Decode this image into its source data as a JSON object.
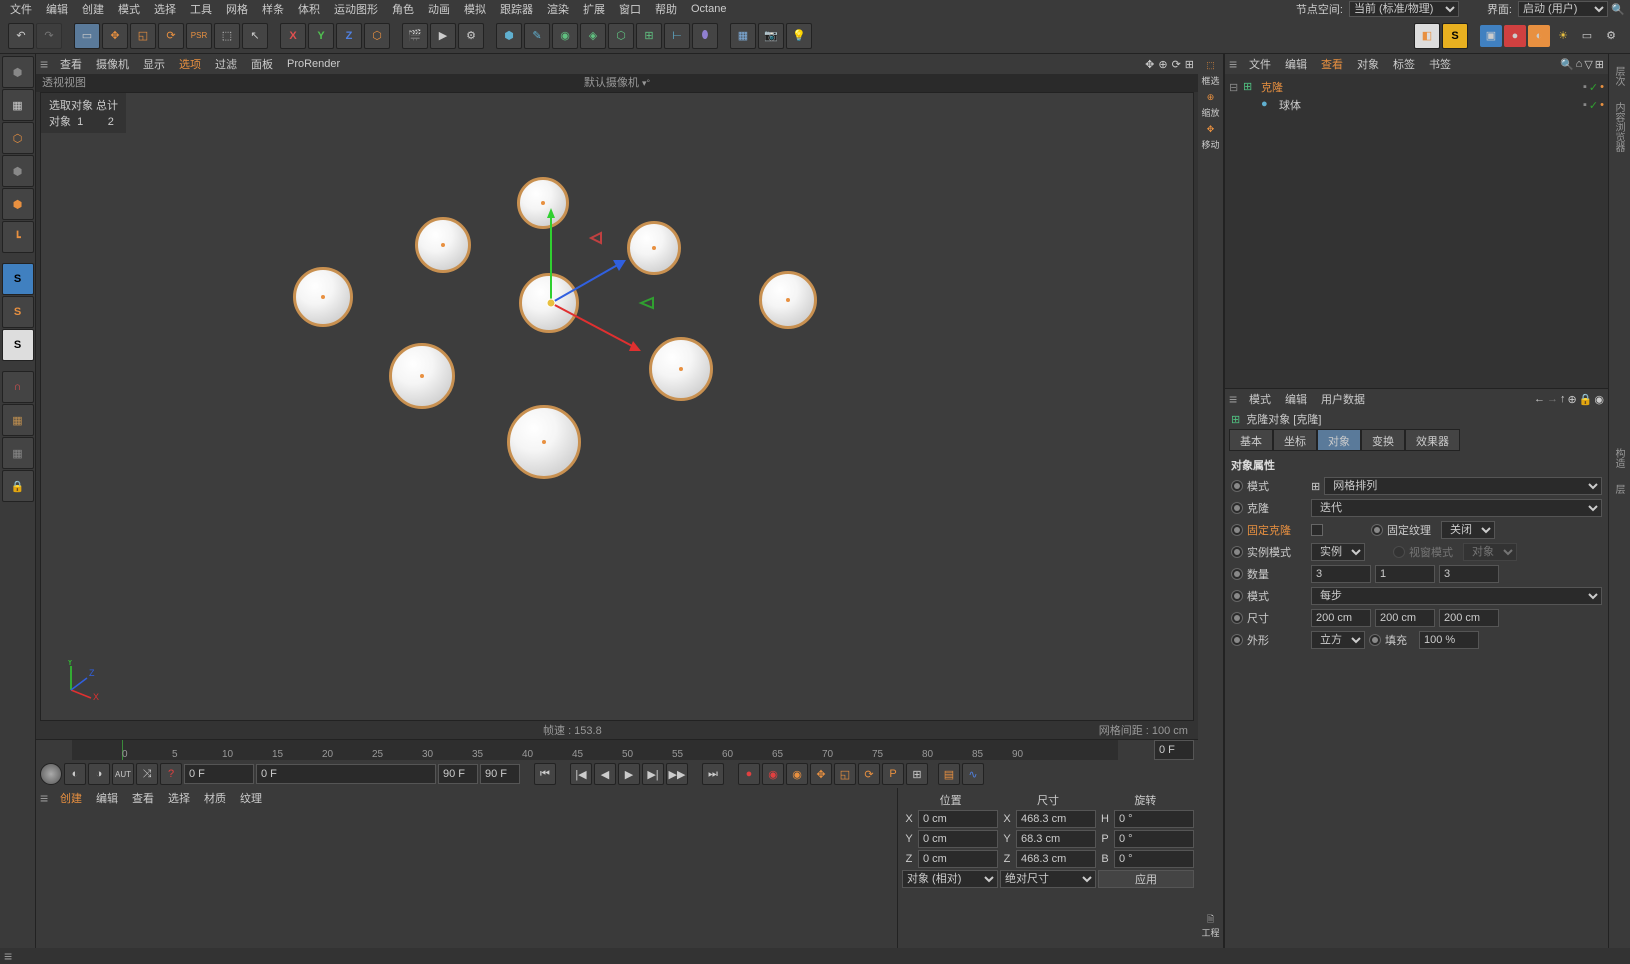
{
  "menubar": {
    "items": [
      "文件",
      "编辑",
      "创建",
      "模式",
      "选择",
      "工具",
      "网格",
      "样条",
      "体积",
      "运动图形",
      "角色",
      "动画",
      "模拟",
      "跟踪器",
      "渲染",
      "扩展",
      "窗口",
      "帮助",
      "Octane"
    ],
    "node_space_label": "节点空间:",
    "node_space_value": "当前 (标准/物理)",
    "layout_label": "界面:",
    "layout_value": "启动 (用户)"
  },
  "viewport_menu": {
    "items": [
      "查看",
      "摄像机",
      "显示",
      "选项",
      "过滤",
      "面板",
      "ProRender"
    ]
  },
  "viewport": {
    "title_left": "透视视图",
    "title_center": "默认摄像机",
    "stats_header": "选取对象 总计",
    "stats_obj_label": "对象",
    "stats_obj_sel": "1",
    "stats_obj_total": "2",
    "footer_fps": "帧速 : 153.8",
    "footer_grid": "网格间距 : 100 cm"
  },
  "timeline": {
    "ticks": [
      "0",
      "5",
      "10",
      "15",
      "20",
      "25",
      "30",
      "35",
      "40",
      "45",
      "50",
      "55",
      "60",
      "65",
      "70",
      "75",
      "80",
      "85",
      "90"
    ],
    "end_input": "0 F",
    "cur_frame": "0 F",
    "range_start": "0 F",
    "range_end": "90 F",
    "total": "90 F"
  },
  "material_menu": {
    "items": [
      "创建",
      "编辑",
      "查看",
      "选择",
      "材质",
      "纹理"
    ]
  },
  "coords": {
    "headers": [
      "位置",
      "尺寸",
      "旋转"
    ],
    "rows": [
      {
        "axis": "X",
        "pos": "0 cm",
        "size_axis": "X",
        "size": "468.3 cm",
        "rot_axis": "H",
        "rot": "0 °"
      },
      {
        "axis": "Y",
        "pos": "0 cm",
        "size_axis": "Y",
        "size": "68.3 cm",
        "rot_axis": "P",
        "rot": "0 °"
      },
      {
        "axis": "Z",
        "pos": "0 cm",
        "size_axis": "Z",
        "size": "468.3 cm",
        "rot_axis": "B",
        "rot": "0 °"
      }
    ],
    "pos_mode": "对象 (相对)",
    "size_mode": "绝对尺寸",
    "apply": "应用"
  },
  "obj_manager": {
    "menu": [
      "文件",
      "编辑",
      "查看",
      "对象",
      "标签",
      "书签"
    ],
    "items": [
      {
        "name": "克隆",
        "type": "cloner"
      },
      {
        "name": "球体",
        "type": "sphere"
      }
    ]
  },
  "mid_strip": {
    "items": [
      "框选",
      "缩放",
      "移动",
      "工程"
    ]
  },
  "attr": {
    "menu": [
      "模式",
      "编辑",
      "用户数据"
    ],
    "title": "克隆对象 [克隆]",
    "tabs": [
      "基本",
      "坐标",
      "对象",
      "变换",
      "效果器"
    ],
    "section_title": "对象属性",
    "mode_label": "模式",
    "mode_value": "网格排列",
    "clone_label": "克隆",
    "clone_value": "迭代",
    "fix_clone_label": "固定克隆",
    "fix_texture_label": "固定纹理",
    "fix_texture_value": "关闭",
    "instance_mode_label": "实例模式",
    "instance_mode_value": "实例",
    "view_mode_label": "视窗模式",
    "view_mode_value": "对象",
    "count_label": "数量",
    "count_x": "3",
    "count_y": "1",
    "count_z": "3",
    "step_mode_label": "模式",
    "step_mode_value": "每步",
    "size_label": "尺寸",
    "size_x": "200 cm",
    "size_y": "200 cm",
    "size_z": "200 cm",
    "shape_label": "外形",
    "shape_value": "立方",
    "fill_label": "填充",
    "fill_value": "100 %"
  }
}
